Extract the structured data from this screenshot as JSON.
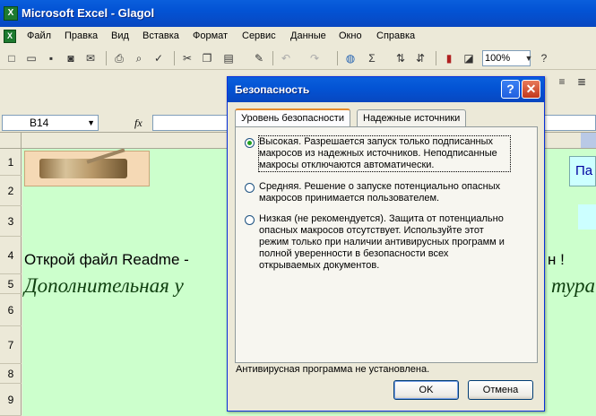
{
  "window": {
    "title": "Microsoft Excel - Glagol"
  },
  "menu": [
    "Файл",
    "Правка",
    "Вид",
    "Вставка",
    "Формат",
    "Сервис",
    "Данные",
    "Окно",
    "Справка"
  ],
  "toolbar": {
    "zoom": "100%",
    "sigma": "Σ",
    "help": "?"
  },
  "formula": {
    "cell_ref": "B14",
    "fx": "fx"
  },
  "rows": [
    "1",
    "2",
    "3",
    "4",
    "5",
    "6",
    "7",
    "8",
    "9"
  ],
  "sheet": {
    "row4_text": "Открой файл Readme -",
    "row4_tail": "н !",
    "row5_text": "Дополнительная у",
    "row5_tail": "тура",
    "right_button": "Па"
  },
  "dialog": {
    "title": "Безопасность",
    "help": "?",
    "close": "✕",
    "tabs": [
      "Уровень безопасности",
      "Надежные источники"
    ],
    "options": [
      {
        "label": "Высокая. Разрешается запуск только подписанных макросов из надежных источников. Неподписанные макросы отключаются автоматически.",
        "selected": true
      },
      {
        "label": "Средняя. Решение о запуске потенциально опасных макросов принимается пользователем.",
        "selected": false
      },
      {
        "label": "Низкая (не рекомендуется). Защита от потенциально опасных макросов отсутствует. Используйте этот режим только при наличии антивирусных программ и полной уверенности в безопасности всех открываемых документов.",
        "selected": false
      }
    ],
    "status": "Антивирусная программа не установлена.",
    "ok": "OK",
    "cancel": "Отмена"
  }
}
